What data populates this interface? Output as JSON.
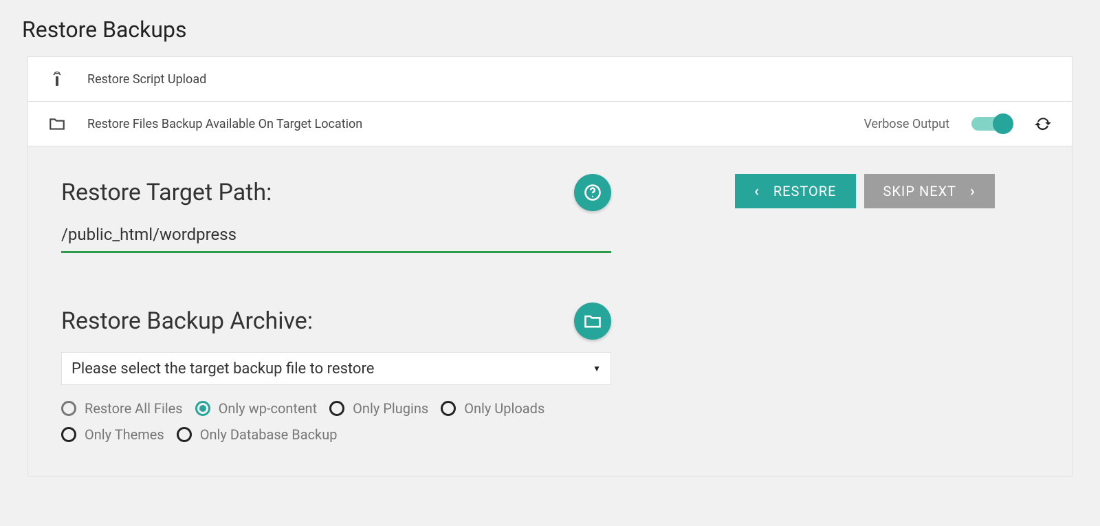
{
  "page": {
    "title": "Restore Backups"
  },
  "accordion": {
    "row1": {
      "label": "Restore Script Upload"
    },
    "row2": {
      "label": "Restore Files Backup Available On Target Location",
      "verbose_label": "Verbose Output",
      "verbose_on": true
    }
  },
  "target_path": {
    "title": "Restore Target Path:",
    "value": "/public_html/wordpress"
  },
  "archive": {
    "title": "Restore Backup Archive:",
    "placeholder": "Please select the target backup file to restore"
  },
  "radios": {
    "all": "Restore All Files",
    "wp_content": "Only wp-content",
    "plugins": "Only Plugins",
    "uploads": "Only Uploads",
    "themes": "Only Themes",
    "db": "Only Database Backup",
    "selected": "wp_content"
  },
  "buttons": {
    "restore": "RESTORE",
    "skip_next": "SKIP NEXT"
  },
  "colors": {
    "accent": "#26a69a",
    "underline": "#2e9a4c"
  }
}
